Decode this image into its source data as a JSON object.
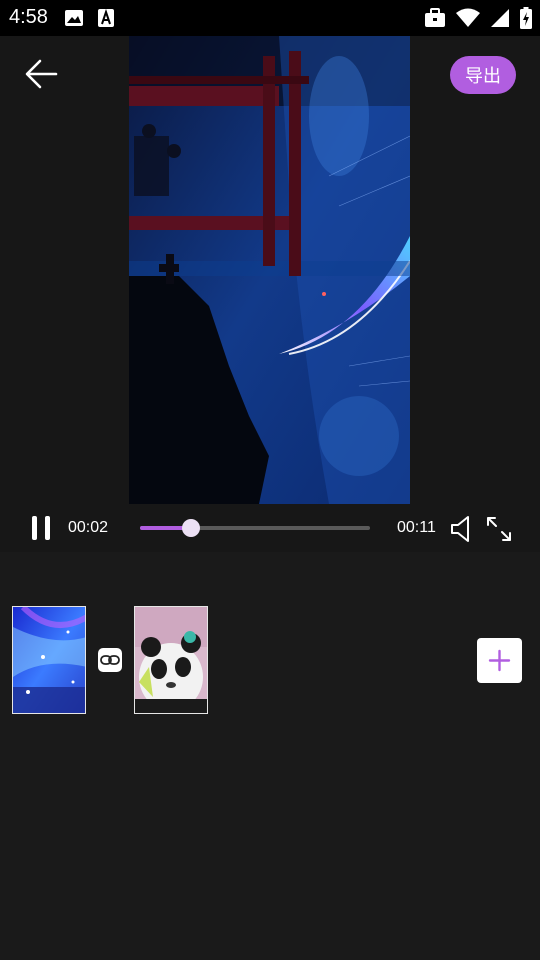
{
  "status_bar": {
    "time": "4:58",
    "left_icons": [
      "image-icon",
      "a-badge-icon"
    ],
    "right_icons": [
      "briefcase-icon",
      "wifi-icon",
      "signal-icon",
      "battery-icon"
    ]
  },
  "header": {
    "back_icon": "arrow-left-icon",
    "export_label": "导出",
    "accent_color": "#b15ee0"
  },
  "player": {
    "current_time": "00:02",
    "total_time": "00:11",
    "progress": 0.22,
    "state": "playing",
    "icons": [
      "pause-icon",
      "volume-icon",
      "fullscreen-icon"
    ]
  },
  "timeline": {
    "clips": [
      {
        "name": "clip-1",
        "thumbnail": "starry-sky"
      },
      {
        "name": "clip-2",
        "thumbnail": "panda"
      }
    ],
    "link_icon": "link-icon",
    "add_icon": "plus-icon"
  }
}
